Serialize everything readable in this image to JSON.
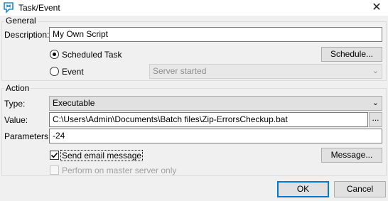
{
  "window": {
    "title": "Task/Event",
    "close_icon": "close-icon",
    "app_icon": "task-event-app-icon"
  },
  "general": {
    "legend": "General",
    "description_label": "Description:",
    "description_value": "My Own Script",
    "scheduled_task_label": "Scheduled Task",
    "scheduled_task_selected": true,
    "schedule_button": "Schedule...",
    "event_label": "Event",
    "event_selected": false,
    "event_value": "Server started"
  },
  "action": {
    "legend": "Action",
    "type_label": "Type:",
    "type_value": "Executable",
    "value_label": "Value:",
    "value_value": "C:\\Users\\Admin\\Documents\\Batch files\\Zip-ErrorsCheckup.bat",
    "browse_button": "...",
    "parameters_label": "Parameters:",
    "parameters_value": "-24",
    "send_email_label": "Send email message",
    "send_email_checked": true,
    "message_button": "Message...",
    "master_only_label": "Perform on master server only",
    "master_only_checked": false
  },
  "footer": {
    "ok_button": "OK",
    "cancel_button": "Cancel"
  },
  "colors": {
    "accent": "#0078d7",
    "window_bg": "#f0f0f0",
    "icon_blue": "#1e88d2"
  }
}
